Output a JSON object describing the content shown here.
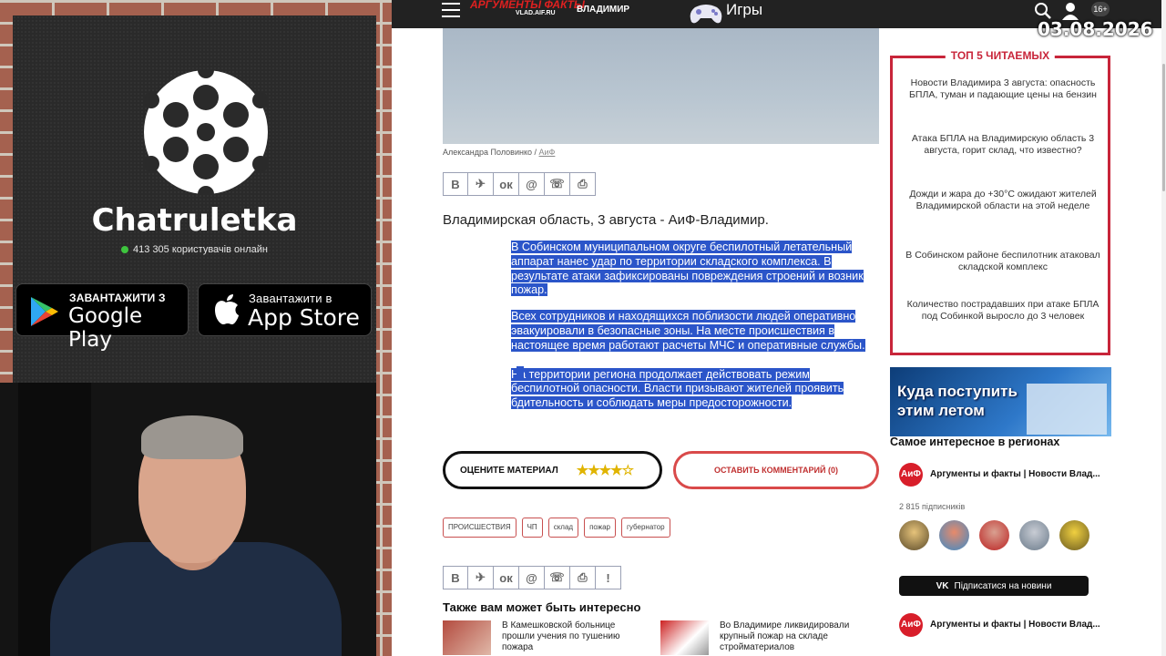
{
  "overlay": {
    "brand": "Chatruletka",
    "online_text": "413 305 користувачів онлайн",
    "google_play": {
      "small": "ЗАВАНТАЖИТИ З",
      "big": "Google Play"
    },
    "app_store": {
      "small": "Завантажити в",
      "big": "App Store"
    },
    "date": "03.08.2026"
  },
  "topbar": {
    "logo_text": "АРГУМЕНТЫ ФАКТЫ",
    "logo_sub": "VLAD.AIF.RU",
    "region": "ВЛАДИМИР",
    "games": "Игры",
    "age": "16+"
  },
  "article": {
    "photo_credit_author": "Александра Половинко",
    "photo_credit_source": "АиФ",
    "share_buttons": [
      "В",
      "✈",
      "ок",
      "@",
      "☏",
      "⎙"
    ],
    "share_buttons_bottom": [
      "В",
      "✈",
      "ок",
      "@",
      "☏",
      "⎙",
      "!"
    ],
    "lead": "Владимирская область, 3 августа - АиФ-Владимир.",
    "paragraphs": [
      "В Собинском муниципальном округе беспилотный летательный аппарат нанес удар по территории складского комплекса. В результате атаки зафиксированы повреждения строений и возник пожар.",
      "Всех сотрудников и находящихся поблизости людей оперативно эвакуировали в безопасные зоны. На месте происшествия в настоящее время работают расчеты МЧС и оперативные службы.",
      "На территории региона продолжает действовать режим беспилотной опасности. Власти призывают жителей проявить бдительность и соблюдать меры предосторожности."
    ],
    "rate_label": "ОЦЕНИТЕ МАТЕРИАЛ",
    "rating_stars": "★★★★☆",
    "rating": 4,
    "comment_label": "ОСТАВИТЬ КОММЕНТАРИЙ (0)",
    "tags": [
      "ПРОИСШЕСТВИЯ",
      "ЧП",
      "склад",
      "пожар",
      "губернатор"
    ],
    "also_title": "Также вам может быть интересно",
    "related": [
      "В Камешковской больнице прошли учения по тушению пожара",
      "Во Владимире ликвидировали крупный пожар на складе стройматериалов"
    ]
  },
  "sidebar": {
    "top5_title": "ТОП 5 ЧИТАЕМЫХ",
    "top5": [
      "Новости Владимира 3 августа: опасность БПЛА, туман и падающие цены на бензин",
      "Атака БПЛА на Владимирскую область 3 августа, горит склад, что известно?",
      "Дожди и жара до +30°С ожидают жителей Владимирской области на этой неделе",
      "В Собинском районе беспилотник атаковал складской комплекс",
      "Количество пострадавших при атаке БПЛА под Собинкой выросло до 3 человек"
    ],
    "banner_text": "Куда поступить этим летом",
    "regions_title": "Самое интересное в регионах",
    "group_name": "Аргументы и факты | Новости Влад...",
    "subscribers": "2 815 підписників",
    "subscribe_label": "Підписатися на новини",
    "vk_icon": "vk-icon"
  }
}
